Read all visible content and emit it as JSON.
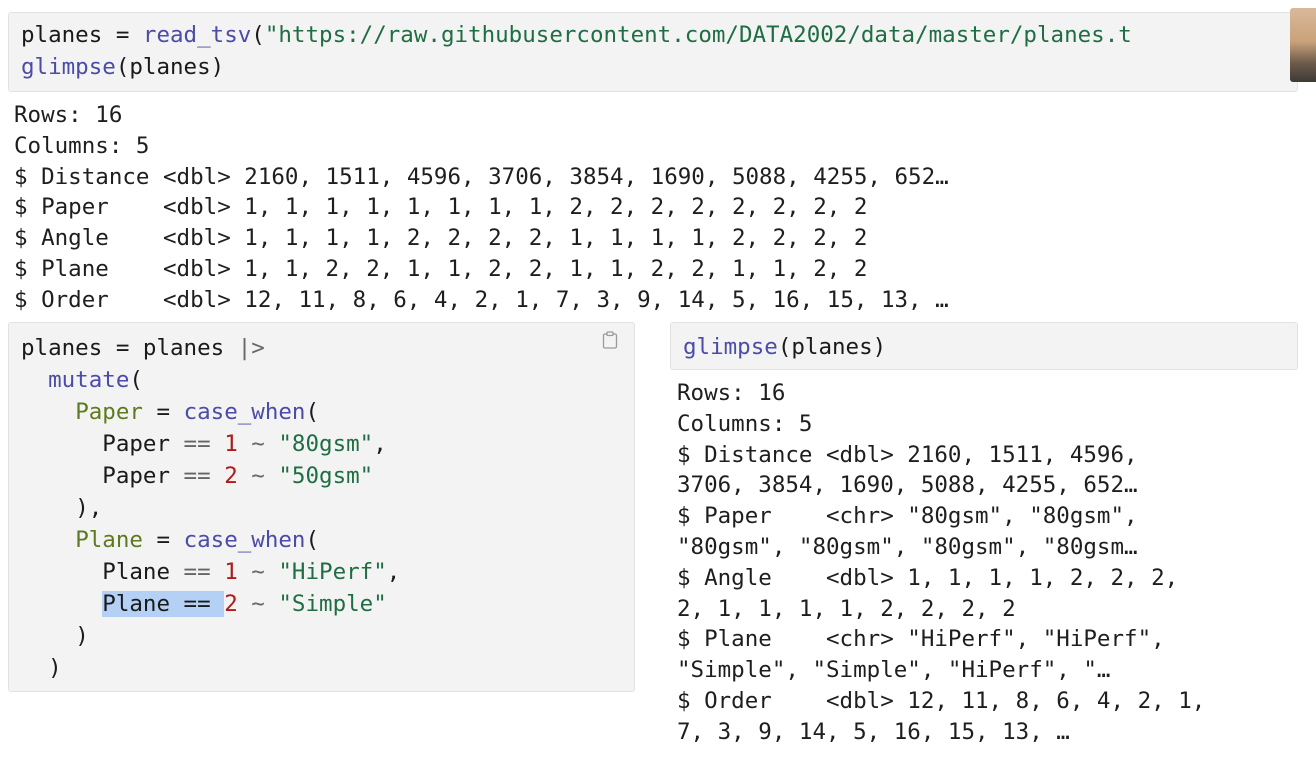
{
  "top_code": {
    "line1": {
      "obj": "planes",
      "assign": " = ",
      "fn": "read_tsv",
      "open": "(",
      "url": "\"https://raw.githubusercontent.com/DATA2002/data/master/planes.t"
    },
    "line2": {
      "fn": "glimpse",
      "rest": "(planes)"
    }
  },
  "top_output": [
    "Rows: 16",
    "Columns: 5",
    "$ Distance <dbl> 2160, 1511, 4596, 3706, 3854, 1690, 5088, 4255, 652…",
    "$ Paper    <dbl> 1, 1, 1, 1, 1, 1, 1, 1, 2, 2, 2, 2, 2, 2, 2, 2",
    "$ Angle    <dbl> 1, 1, 1, 1, 2, 2, 2, 2, 1, 1, 1, 1, 2, 2, 2, 2",
    "$ Plane    <dbl> 1, 1, 2, 2, 1, 1, 2, 2, 1, 1, 2, 2, 1, 1, 2, 2",
    "$ Order    <dbl> 12, 11, 8, 6, 4, 2, 1, 7, 3, 9, 14, 5, 16, 15, 13, …"
  ],
  "mutate_code": {
    "l1": {
      "text": "planes = planes ",
      "pipe": "|>"
    },
    "l2": {
      "fn": "mutate",
      "rest": "("
    },
    "l3": {
      "arg": "Paper",
      "eq": " = ",
      "fn": "case_when",
      "rest": "("
    },
    "l4": {
      "var": "Paper",
      "op": " == ",
      "num": "1",
      "tilde": " ~ ",
      "str": "\"80gsm\"",
      "rest": ","
    },
    "l5": {
      "var": "Paper",
      "op": " == ",
      "num": "2",
      "tilde": " ~ ",
      "str": "\"50gsm\""
    },
    "l6": {
      "text": "),"
    },
    "l7": {
      "arg": "Plane",
      "eq": " = ",
      "fn": "case_when",
      "rest": "("
    },
    "l8": {
      "var": "Plane",
      "op": " == ",
      "num": "1",
      "tilde": " ~ ",
      "str": "\"HiPerf\"",
      "rest": ","
    },
    "l9": {
      "sel": "Plane == ",
      "num": "2",
      "tilde": " ~ ",
      "str": "\"Simple\""
    },
    "l10": {
      "text": ")"
    },
    "l11": {
      "text": ")"
    }
  },
  "glimpse_code": {
    "fn": "glimpse",
    "rest": "(planes)"
  },
  "right_output": [
    "Rows: 16",
    "Columns: 5",
    "$ Distance <dbl> 2160, 1511, 4596,",
    "3706, 3854, 1690, 5088, 4255, 652…",
    "$ Paper    <chr> \"80gsm\", \"80gsm\",",
    "\"80gsm\", \"80gsm\", \"80gsm\", \"80gsm…",
    "$ Angle    <dbl> 1, 1, 1, 1, 2, 2, 2,",
    "2, 1, 1, 1, 1, 2, 2, 2, 2",
    "$ Plane    <chr> \"HiPerf\", \"HiPerf\",",
    "\"Simple\", \"Simple\", \"HiPerf\", \"…",
    "$ Order    <dbl> 12, 11, 8, 6, 4, 2, 1,",
    "7, 3, 9, 14, 5, 16, 15, 13, …"
  ],
  "icons": {
    "copy": "clipboard-icon"
  }
}
